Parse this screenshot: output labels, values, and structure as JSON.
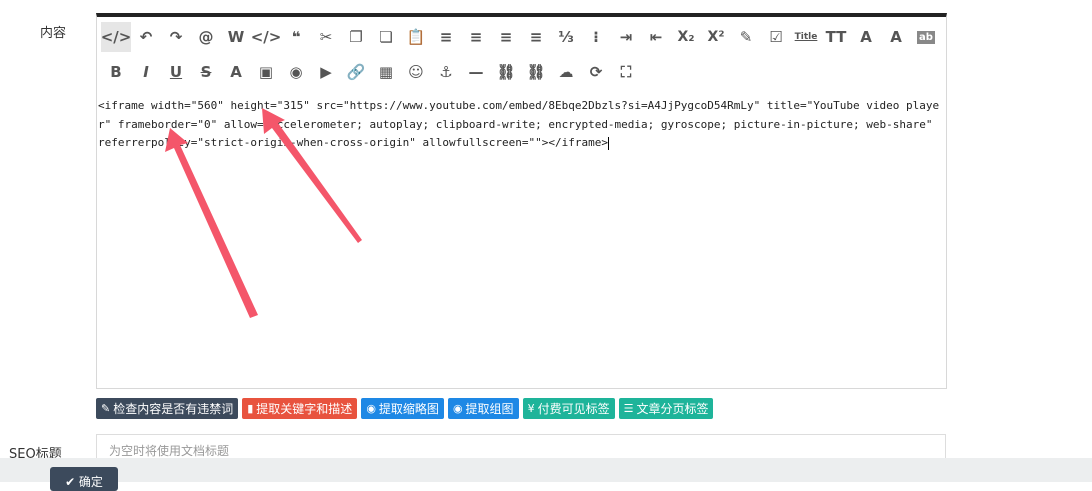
{
  "form": {
    "content_label": "内容",
    "seo_title_label": "SEO标题",
    "seo_title_placeholder": "为空时将使用文档标题"
  },
  "toolbar": {
    "row1": [
      {
        "icon": "source-code-icon",
        "glyph": "</>",
        "active": true
      },
      {
        "icon": "undo-icon",
        "glyph": "↶"
      },
      {
        "icon": "redo-icon",
        "glyph": "↷"
      },
      {
        "icon": "mention-icon",
        "glyph": "@"
      },
      {
        "icon": "word-paste-icon",
        "glyph": "W"
      },
      {
        "icon": "code-icon",
        "glyph": "</>"
      },
      {
        "icon": "quote-icon",
        "glyph": "❝"
      },
      {
        "icon": "cut-icon",
        "glyph": "✂"
      },
      {
        "icon": "copy-icon",
        "glyph": "❐"
      },
      {
        "icon": "paste-text-icon",
        "glyph": "❏"
      },
      {
        "icon": "paste-icon",
        "glyph": "📋"
      },
      {
        "icon": "align-left-icon",
        "glyph": "≡"
      },
      {
        "icon": "align-center-icon",
        "glyph": "≡"
      },
      {
        "icon": "align-right-icon",
        "glyph": "≡"
      },
      {
        "icon": "justify-icon",
        "glyph": "≡"
      },
      {
        "icon": "ordered-list-icon",
        "glyph": "⅓"
      },
      {
        "icon": "unordered-list-icon",
        "glyph": "⁝"
      },
      {
        "icon": "indent-icon",
        "glyph": "⇥"
      },
      {
        "icon": "outdent-icon",
        "glyph": "⇤"
      },
      {
        "icon": "subscript-icon",
        "glyph": "X₂"
      },
      {
        "icon": "superscript-icon",
        "glyph": "X²"
      },
      {
        "icon": "format-painter-icon",
        "glyph": "✎"
      },
      {
        "icon": "select-all-icon",
        "glyph": "☑"
      },
      {
        "icon": "title-icon",
        "glyph": "Title"
      },
      {
        "icon": "font-size-icon",
        "glyph": "TT"
      },
      {
        "icon": "font-family-icon",
        "glyph": "A"
      },
      {
        "icon": "font-color-icon",
        "glyph": "A"
      },
      {
        "icon": "background-color-icon",
        "glyph": "ab"
      }
    ],
    "row2": [
      {
        "icon": "bold-icon",
        "glyph": "B"
      },
      {
        "icon": "italic-icon",
        "glyph": "I"
      },
      {
        "icon": "underline-icon",
        "glyph": "U"
      },
      {
        "icon": "strikethrough-icon",
        "glyph": "S"
      },
      {
        "icon": "remove-format-icon",
        "glyph": "A"
      },
      {
        "icon": "image-icon",
        "glyph": "▣"
      },
      {
        "icon": "emoji-palette-icon",
        "glyph": "◉"
      },
      {
        "icon": "video-icon",
        "glyph": "▶"
      },
      {
        "icon": "link-icon",
        "glyph": "🔗"
      },
      {
        "icon": "table-icon",
        "glyph": "▦"
      },
      {
        "icon": "emoticon-icon",
        "glyph": "☺"
      },
      {
        "icon": "anchor-icon",
        "glyph": "⚓"
      },
      {
        "icon": "horizontal-rule-icon",
        "glyph": "—"
      },
      {
        "icon": "insert-link-icon",
        "glyph": "⛓"
      },
      {
        "icon": "unlink-icon",
        "glyph": "⛓"
      },
      {
        "icon": "upload-cloud-icon",
        "glyph": "☁"
      },
      {
        "icon": "search-replace-icon",
        "glyph": "⟳"
      },
      {
        "icon": "fullscreen-icon",
        "glyph": "⛶"
      }
    ]
  },
  "editor": {
    "content": "<iframe width=\"560\" height=\"315\" src=\"https://www.youtube.com/embed/8Ebqe2Dbzls?si=A4JjPygcoD54RmLy\" title=\"YouTube video player\" frameborder=\"0\" allow=\"accelerometer; autoplay; clipboard-write; encrypted-media; gyroscope; picture-in-picture; web-share\" referrerpolicy=\"strict-origin-when-cross-origin\" allowfullscreen=\"\"></iframe>"
  },
  "actions": [
    {
      "name": "check-banned-words-button",
      "icon": "✎",
      "label": "检查内容是否有违禁词",
      "color": "#3c4a5c"
    },
    {
      "name": "extract-keywords-button",
      "icon": "▮",
      "label": "提取关键字和描述",
      "color": "#e8533e"
    },
    {
      "name": "extract-thumbnail-button",
      "icon": "◉",
      "label": "提取缩略图",
      "color": "#1e88e5"
    },
    {
      "name": "extract-gallery-button",
      "icon": "◉",
      "label": "提取组图",
      "color": "#1e88e5"
    },
    {
      "name": "paid-visible-tag-button",
      "icon": "¥",
      "label": "付费可见标签",
      "color": "#1eb49a"
    },
    {
      "name": "pagination-tag-button",
      "icon": "☰",
      "label": "文章分页标签",
      "color": "#1eb49a"
    }
  ],
  "footer": {
    "confirm_label": "✔ 确定"
  },
  "annotation_color": "#f4566a"
}
